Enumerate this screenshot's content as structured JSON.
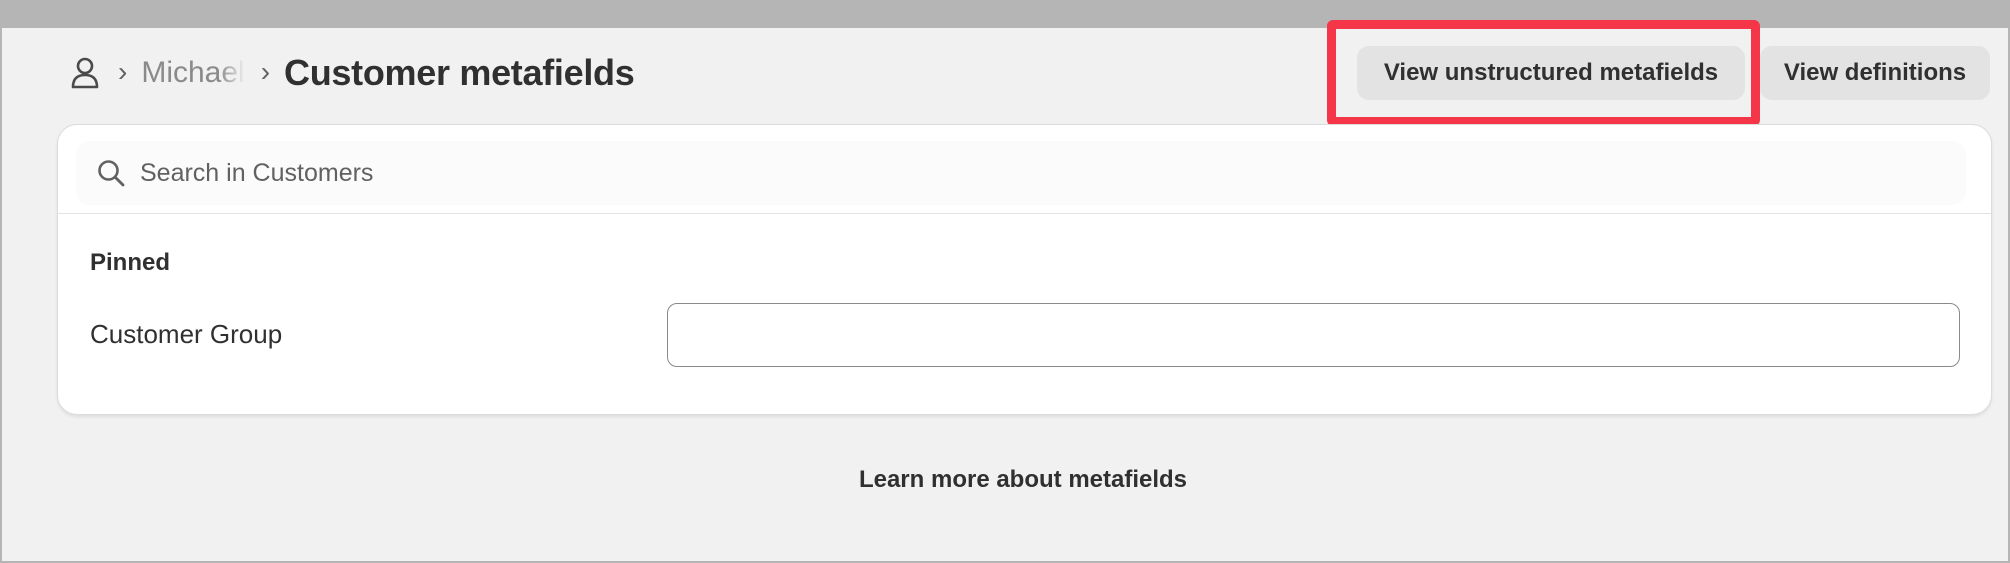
{
  "header": {
    "breadcrumb_parent": "Michael",
    "breadcrumb_separator": "›",
    "title": "Customer metafields"
  },
  "actions": {
    "view_unstructured_label": "View unstructured metafields",
    "view_definitions_label": "View definitions",
    "highlight_color": "#f43648"
  },
  "search": {
    "placeholder": "Search in Customers",
    "value": ""
  },
  "pinned": {
    "section_label": "Pinned",
    "fields": [
      {
        "label": "Customer Group",
        "value": ""
      }
    ]
  },
  "footer": {
    "learn_more_label": "Learn more about metafields"
  },
  "icons": {
    "customer": "person-icon",
    "search": "search-icon"
  }
}
